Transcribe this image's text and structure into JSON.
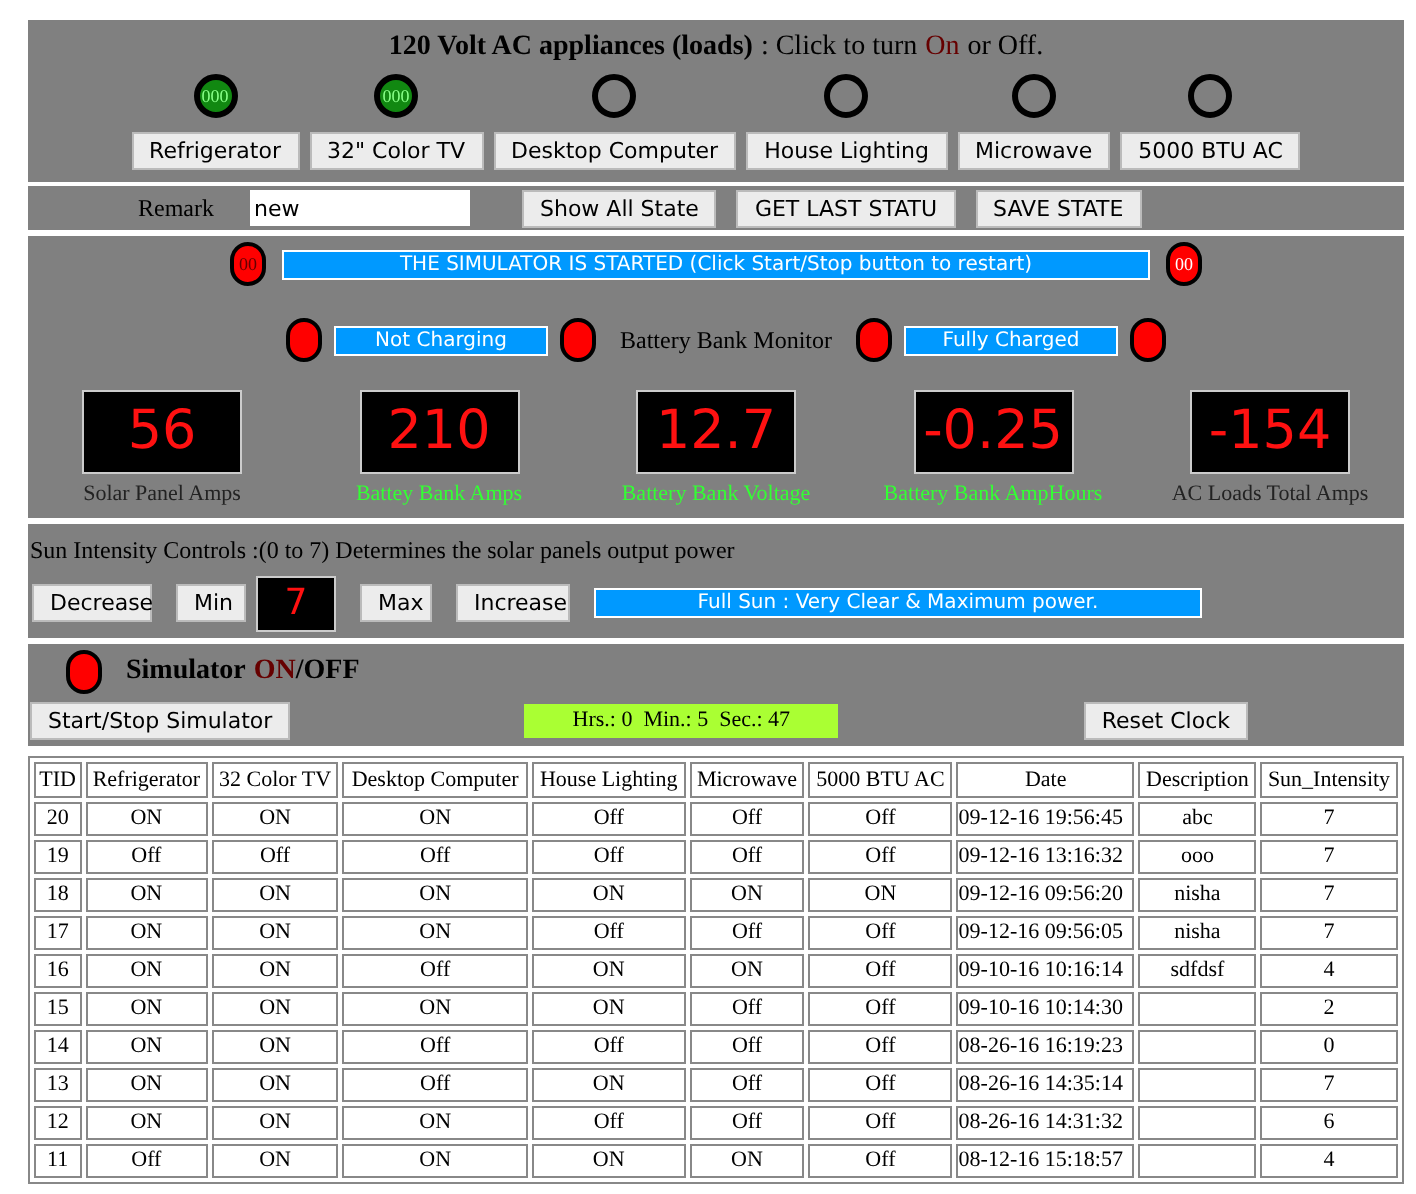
{
  "appliances_panel": {
    "heading": "120 Volt AC appliances (loads)",
    "prompt": ": Click to turn",
    "highlight": "On",
    "tail": "or Off.",
    "appliances": [
      {
        "name": "Refrigerator",
        "on": true,
        "lamp_text": "000"
      },
      {
        "name": "32\" Color TV",
        "on": true,
        "lamp_text": "000"
      },
      {
        "name": "Desktop Computer",
        "on": false
      },
      {
        "name": "House Lighting",
        "on": false
      },
      {
        "name": "Microwave",
        "on": false
      },
      {
        "name": "5000 BTU AC",
        "on": false
      }
    ]
  },
  "remark_bar": {
    "label": "Remark",
    "value": "new",
    "buttons": [
      "Show All State",
      "GET LAST STATU",
      "SAVE STATE"
    ]
  },
  "monitor_panel": {
    "left_lamp": "00",
    "banner": "THE SIMULATOR IS STARTED  (Click Start/Stop button to restart)",
    "right_lamp": "00",
    "charge_status": "Not Charging",
    "monitor_label": "Battery Bank Monitor",
    "full_status": "Fully Charged",
    "meters": [
      {
        "value": "56",
        "label": "Solar Panel Amps",
        "color": "#222222"
      },
      {
        "value": "210",
        "label": "Battey Bank Amps",
        "color": "#33ff33"
      },
      {
        "value": "12.7",
        "label": "Battery Bank Voltage",
        "color": "#33ff33"
      },
      {
        "value": "-0.25",
        "label": "Battery Bank AmpHours",
        "color": "#33ff33"
      },
      {
        "value": "-154",
        "label": "AC Loads Total Amps",
        "color": "#222222"
      }
    ]
  },
  "sun_panel": {
    "title": "Sun Intensity Controls :(0 to 7) Determines the solar panels output power",
    "decrease": "Decrease",
    "min": "Min",
    "display": "7",
    "max": "Max",
    "increase": "Increase",
    "banner": "Full Sun : Very Clear & Maximum power."
  },
  "simulator_panel": {
    "label": "Simulator",
    "on_word": "ON",
    "off_word": "/OFF",
    "start_button": "Start/Stop Simulator",
    "clock": "Hrs.: 0  Min.: 5  Sec.: 47",
    "reset_button": "Reset Clock"
  },
  "table": {
    "columns": [
      "TID",
      "Refrigerator",
      "32 Color TV",
      "Desktop Computer",
      "House Lighting",
      "Microwave",
      "5000 BTU AC",
      "Date",
      "Description",
      "Sun_Intensity"
    ],
    "rows": [
      [
        "20",
        "ON",
        "ON",
        "ON",
        "Off",
        "Off",
        "Off",
        "09-12-16 19:56:45",
        "abc",
        "7"
      ],
      [
        "19",
        "Off",
        "Off",
        "Off",
        "Off",
        "Off",
        "Off",
        "09-12-16 13:16:32",
        "ooo",
        "7"
      ],
      [
        "18",
        "ON",
        "ON",
        "ON",
        "ON",
        "ON",
        "ON",
        "09-12-16 09:56:20",
        "nisha",
        "7"
      ],
      [
        "17",
        "ON",
        "ON",
        "ON",
        "Off",
        "Off",
        "Off",
        "09-12-16 09:56:05",
        "nisha",
        "7"
      ],
      [
        "16",
        "ON",
        "ON",
        "Off",
        "ON",
        "ON",
        "Off",
        "09-10-16 10:16:14",
        "sdfdsf",
        "4"
      ],
      [
        "15",
        "ON",
        "ON",
        "ON",
        "ON",
        "Off",
        "Off",
        "09-10-16 10:14:30",
        "",
        "2"
      ],
      [
        "14",
        "ON",
        "ON",
        "Off",
        "Off",
        "Off",
        "Off",
        "08-26-16 16:19:23",
        "",
        "0"
      ],
      [
        "13",
        "ON",
        "ON",
        "Off",
        "ON",
        "Off",
        "Off",
        "08-26-16 14:35:14",
        "",
        "7"
      ],
      [
        "12",
        "ON",
        "ON",
        "ON",
        "Off",
        "Off",
        "Off",
        "08-26-16 14:31:32",
        "",
        "6"
      ],
      [
        "11",
        "Off",
        "ON",
        "ON",
        "ON",
        "ON",
        "Off",
        "08-12-16 15:18:57",
        "",
        "4"
      ]
    ]
  }
}
